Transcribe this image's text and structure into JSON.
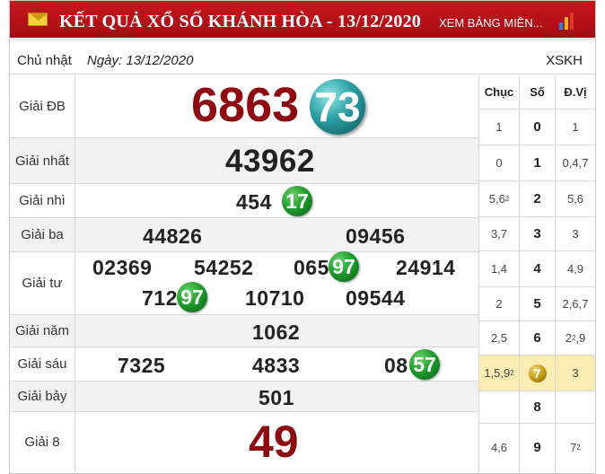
{
  "header": {
    "title": "KẾT QUẢ XỔ SỐ KHÁNH HÒA - 13/12/2020",
    "view_all": "XEM BẢNG MIỀN...",
    "icon": "mail-icon",
    "chart_icon": "bar-chart-icon",
    "bg_color": "#b5121b"
  },
  "date_row": {
    "day": "Chủ nhật",
    "date": "Ngày: 13/12/2020",
    "code": "XSKH"
  },
  "prizes": {
    "db": {
      "label": "Giải ĐB",
      "main": "6863",
      "tail": "73"
    },
    "g1": {
      "label": "Giải nhất",
      "value": "43962"
    },
    "g2": {
      "label": "Giải nhì",
      "main": "454",
      "tail": "17"
    },
    "g3": {
      "label": "Giải ba",
      "values": [
        "44826",
        "09456"
      ]
    },
    "g4": {
      "label": "Giải tư",
      "values": [
        "02369",
        "54252"
      ],
      "v3_main": "065",
      "v3_tail": "97",
      "v4": "24914",
      "v5_main": "712",
      "v5_tail": "97",
      "v6": "10710",
      "v7": "09544"
    },
    "g5": {
      "label": "Giải năm",
      "value": "1062"
    },
    "g6": {
      "label": "Giải sáu",
      "values": [
        "7325",
        "4833"
      ],
      "v3_main": "08",
      "v3_tail": "57"
    },
    "g7": {
      "label": "Giải bảy",
      "value": "501"
    },
    "g8": {
      "label": "Giải 8",
      "value": "49"
    }
  },
  "loto_table": {
    "headers": [
      "Chục",
      "Số",
      "Đ.Vị"
    ],
    "rows": [
      {
        "chuc": "1",
        "so": "0",
        "dv": "1"
      },
      {
        "chuc": "0",
        "so": "1",
        "dv": "0,4,7"
      },
      {
        "chuc": "5,6",
        "chuc_sup": "2",
        "so": "2",
        "dv": "5,6"
      },
      {
        "chuc": "3,7",
        "so": "3",
        "dv": "3"
      },
      {
        "chuc": "1,4",
        "so": "4",
        "dv": "4,9"
      },
      {
        "chuc": "2",
        "so": "5",
        "dv": "2,6,7"
      },
      {
        "chuc": "2,5",
        "so": "6",
        "dv": "2",
        "dv_sup": "2",
        "dv_tail": ",9"
      },
      {
        "chuc": "1,5,9",
        "chuc_sup": "2",
        "so": "7",
        "dv": "3",
        "highlight": true
      },
      {
        "chuc": "",
        "so": "8",
        "dv": ""
      },
      {
        "chuc": "4,6",
        "so": "9",
        "dv": "7",
        "dv_sup": "2"
      }
    ]
  },
  "colors": {
    "special_prize": "#8d0b10",
    "ball_green": "#1f9d2c",
    "ball_teal": "#2a9ea3",
    "highlight_row": "#fbecb3"
  }
}
